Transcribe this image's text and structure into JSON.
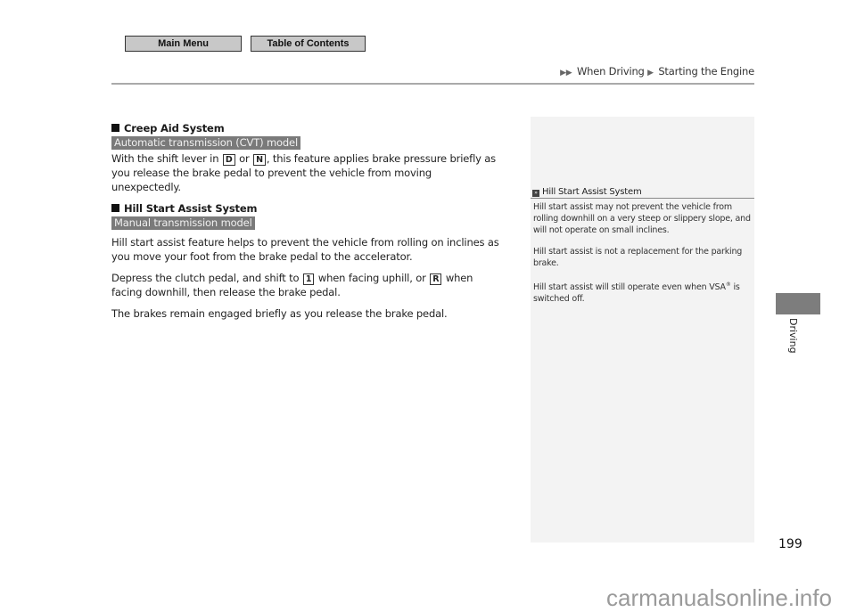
{
  "nav": {
    "main_menu": "Main Menu",
    "table_of_contents": "Table of Contents"
  },
  "breadcrumb": {
    "prefix_icon": "double-triangle-icon",
    "level1": "When Driving",
    "level2": "Starting the Engine"
  },
  "sections": [
    {
      "heading": "Creep Aid System",
      "badge": "Automatic transmission (CVT) model",
      "p1_a": "With the shift lever in ",
      "key1": "D",
      "p1_b": " or ",
      "key2": "N",
      "p1_c": ", this feature applies brake pressure briefly as you release the brake pedal to prevent the vehicle from moving unexpectedly."
    },
    {
      "heading": "Hill Start Assist System",
      "badge": "Manual transmission model",
      "p1": "Hill start assist feature helps to prevent the vehicle from rolling on inclines as you move your foot from the brake pedal to the accelerator.",
      "p2_a": "Depress the clutch pedal, and shift to ",
      "key1": "1",
      "p2_b": " when facing uphill, or ",
      "key2": "R",
      "p2_c": " when facing downhill, then release the brake pedal.",
      "p3": "The brakes remain engaged briefly as you release the brake pedal."
    }
  ],
  "sidebar": {
    "title": "Hill Start Assist System",
    "notes": [
      "Hill start assist may not prevent the vehicle from rolling downhill on a very steep or slippery slope, and will not operate on small inclines.",
      "Hill start assist is not a replacement for the parking brake."
    ],
    "note3_a": "Hill start assist will still operate even when VSA",
    "note3_sup": "®",
    "note3_b": " is switched off."
  },
  "chapter_tab": "Driving",
  "page_number": "199",
  "watermark": "carmanualsonline.info"
}
